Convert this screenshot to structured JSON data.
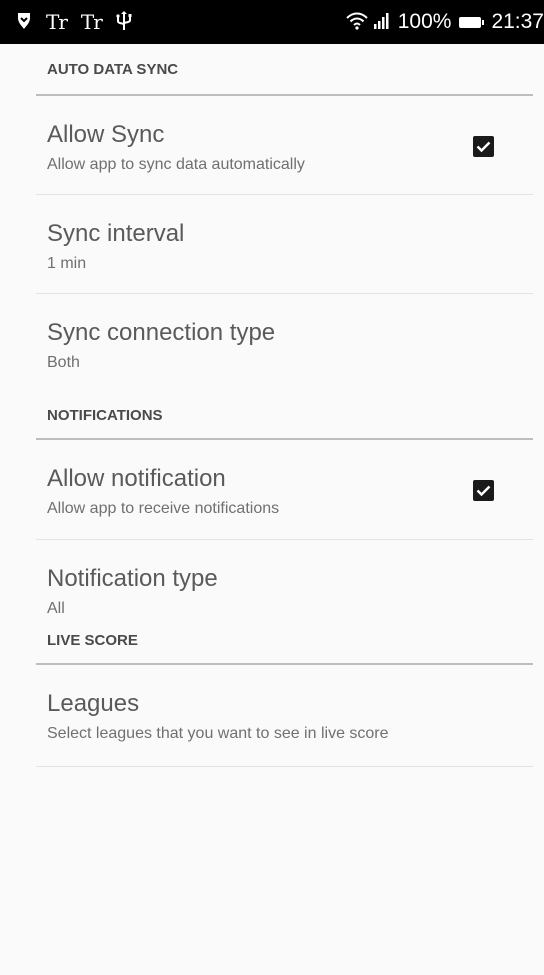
{
  "status_bar": {
    "icons": [
      "vpn-shield-icon",
      "text-size-icon",
      "text-size-icon",
      "usb-icon",
      "wifi-icon",
      "signal-icon",
      "battery-icon"
    ],
    "tt1": "Tr",
    "tt2": "Tr",
    "battery": "100%",
    "time": "21:37"
  },
  "sections": {
    "auto_sync": {
      "header": "AUTO DATA SYNC",
      "allow_sync": {
        "title": "Allow Sync",
        "summary": "Allow app to sync data automatically",
        "checked": true
      },
      "sync_interval": {
        "title": "Sync interval",
        "summary": "1 min"
      },
      "connection_type": {
        "title": "Sync connection type",
        "summary": "Both"
      }
    },
    "notifications": {
      "header": "NOTIFICATIONS",
      "allow_notification": {
        "title": "Allow notification",
        "summary": "Allow app to receive notifications",
        "checked": true
      },
      "notification_type": {
        "title": "Notification type",
        "summary": "All"
      }
    },
    "live_score": {
      "header": "LIVE SCORE",
      "leagues": {
        "title": "Leagues",
        "summary": "Select leagues that you want to see in live score"
      }
    }
  },
  "colors": {
    "background": "#fafafa",
    "status_bar": "#000000",
    "checkbox": "#1a1a1a",
    "divider": "#bdbdbd"
  }
}
